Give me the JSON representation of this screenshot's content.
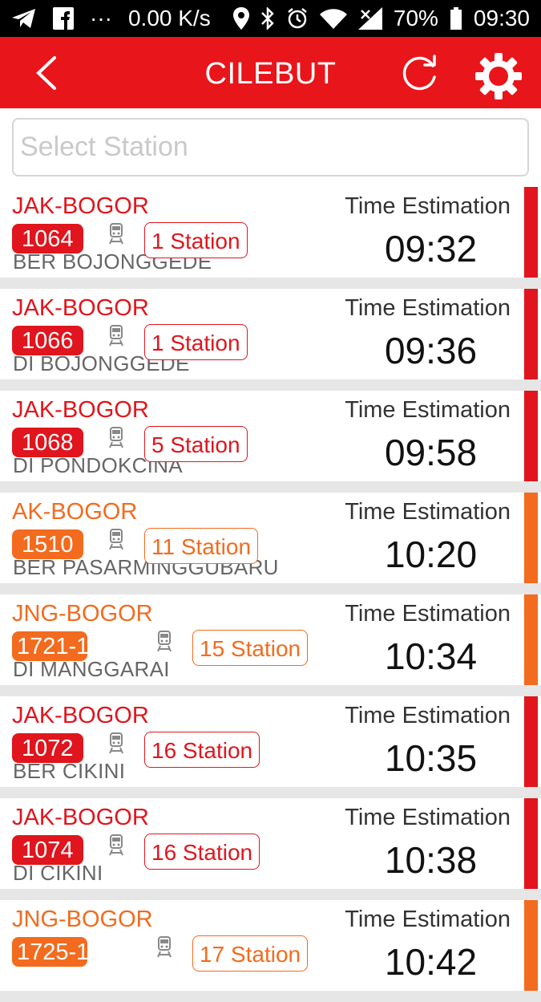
{
  "status_bar": {
    "speed": "0.00 K/s",
    "dots": "···",
    "battery": "70%",
    "clock": "09:30",
    "icons": [
      "telegram-icon",
      "facebook-icon",
      "location-icon",
      "bluetooth-icon",
      "alarm-icon",
      "wifi-icon",
      "signal-icon",
      "battery-icon"
    ]
  },
  "header": {
    "title": "CILEBUT",
    "back_icon": "chevron-left-icon",
    "refresh_icon": "refresh-icon",
    "settings_icon": "gear-icon",
    "color": "#e8151b"
  },
  "search": {
    "placeholder": "Select Station",
    "value": ""
  },
  "colors": {
    "red": "#e0151d",
    "orange": "#f26b1e"
  },
  "schedule": [
    {
      "route": "JAK-BOGOR",
      "train": "1064",
      "stations": "1 Station",
      "destination": "BER BOJONGGEDE",
      "time_label": "Time Estimation",
      "time": "09:32",
      "color": "red"
    },
    {
      "route": "JAK-BOGOR",
      "train": "1066",
      "stations": "1 Station",
      "destination": "DI BOJONGGEDE",
      "time_label": "Time Estimation",
      "time": "09:36",
      "color": "red"
    },
    {
      "route": "JAK-BOGOR",
      "train": "1068",
      "stations": "5 Station",
      "destination": "DI PONDOKCINA",
      "time_label": "Time Estimation",
      "time": "09:58",
      "color": "red"
    },
    {
      "route": "AK-BOGOR",
      "train": "1510",
      "stations": "11 Station",
      "destination": "BER PASARMINGGUBARU",
      "time_label": "Time Estimation",
      "time": "10:20",
      "color": "orange"
    },
    {
      "route": "JNG-BOGOR",
      "train": "1721-1",
      "stations": "15 Station",
      "destination": "DI MANGGARAI",
      "time_label": "Time Estimation",
      "time": "10:34",
      "color": "orange"
    },
    {
      "route": "JAK-BOGOR",
      "train": "1072",
      "stations": "16 Station",
      "destination": "BER CIKINI",
      "time_label": "Time Estimation",
      "time": "10:35",
      "color": "red"
    },
    {
      "route": "JAK-BOGOR",
      "train": "1074",
      "stations": "16 Station",
      "destination": "DI CIKINI",
      "time_label": "Time Estimation",
      "time": "10:38",
      "color": "red"
    },
    {
      "route": "JNG-BOGOR",
      "train": "1725-1",
      "stations": "17 Station",
      "destination": "",
      "time_label": "Time Estimation",
      "time": "10:42",
      "color": "orange"
    }
  ]
}
